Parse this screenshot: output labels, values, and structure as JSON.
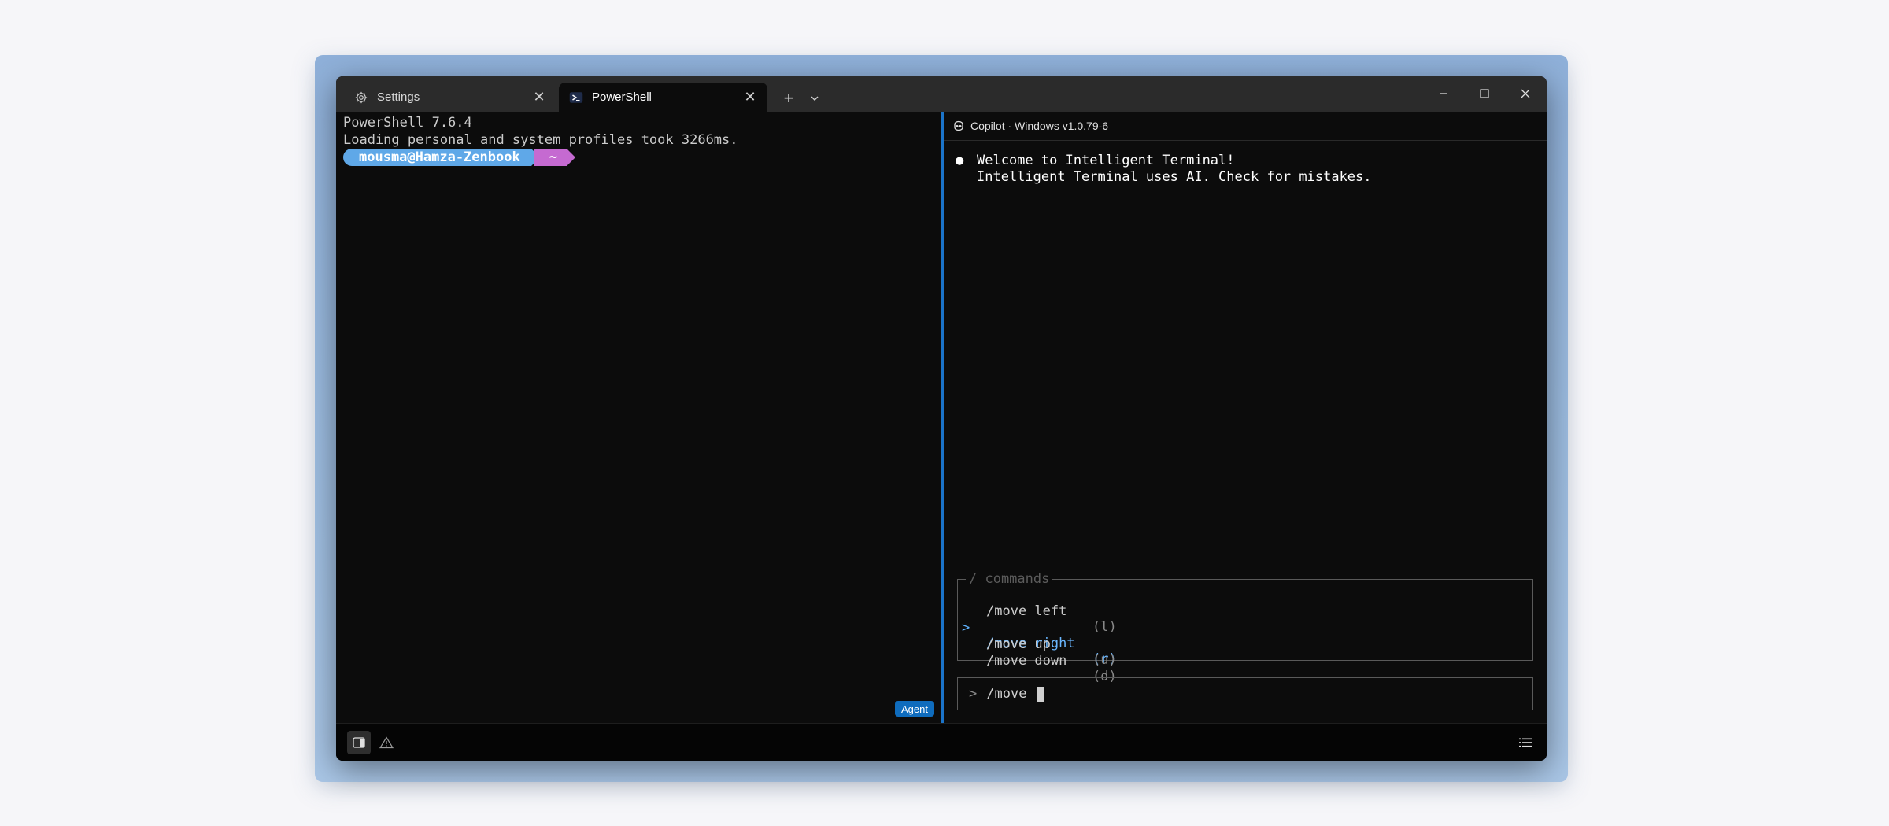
{
  "tabs": [
    {
      "label": "Settings",
      "icon": "gear-icon",
      "active": false
    },
    {
      "label": "PowerShell",
      "icon": "powershell-icon",
      "active": true
    }
  ],
  "titlebar": {
    "new_tab_glyph": "+",
    "close_glyph": "✕"
  },
  "terminal": {
    "version_line": "PowerShell 7.6.4",
    "loading_line": "Loading personal and system profiles took 3266ms.",
    "prompt_user": "mousma@Hamza-Zenbook",
    "prompt_dir": "~",
    "agent_badge": "Agent"
  },
  "copilot": {
    "header": "Copilot · Windows v1.0.79-6",
    "bullet": "●",
    "welcome_title": "Welcome to Intelligent Terminal!",
    "welcome_note": "Intelligent Terminal uses AI. Check for mistakes.",
    "commands_legend": "/ commands",
    "selected_marker": ">",
    "commands": [
      {
        "name": "/move left",
        "key": "(l)",
        "selected": false
      },
      {
        "name": "/move right",
        "key": "(r)",
        "selected": true
      },
      {
        "name": "/move up",
        "key": "(u)",
        "selected": false
      },
      {
        "name": "/move down",
        "key": "(d)",
        "selected": false
      }
    ],
    "input_prompt": ">",
    "input_value": "/move "
  },
  "colors": {
    "accent": "#1b74c9",
    "prompt_user_bg": "#5fa8e8",
    "prompt_dir_bg": "#c56ad1",
    "agent_badge_bg": "#0f6cbd",
    "selected_command": "#6ab7ff"
  }
}
